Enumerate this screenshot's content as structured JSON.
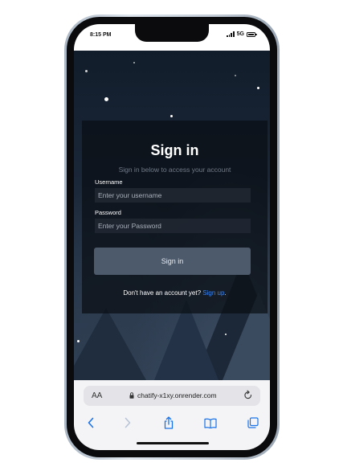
{
  "status_bar": {
    "time": "8:15 PM",
    "network": "5G"
  },
  "login": {
    "title": "Sign in",
    "subtitle": "Sign in below to access your account",
    "username_label": "Username",
    "username_placeholder": "Enter your username",
    "password_label": "Password",
    "password_placeholder": "Enter your Password",
    "submit_label": "Sign in",
    "signup_prompt": "Don't have an account yet?",
    "signup_link": "Sign up",
    "signup_suffix": "."
  },
  "browser": {
    "text_size_label": "AA",
    "url": "chatify-x1xy.onrender.com"
  },
  "colors": {
    "link": "#3b86f5",
    "button": "#4d5a6c",
    "card": "#0a0e14"
  },
  "icons": [
    "lock-icon",
    "reload-icon",
    "back-icon",
    "forward-icon",
    "share-icon",
    "bookmarks-icon",
    "tabs-icon",
    "signal-icon",
    "battery-icon"
  ]
}
